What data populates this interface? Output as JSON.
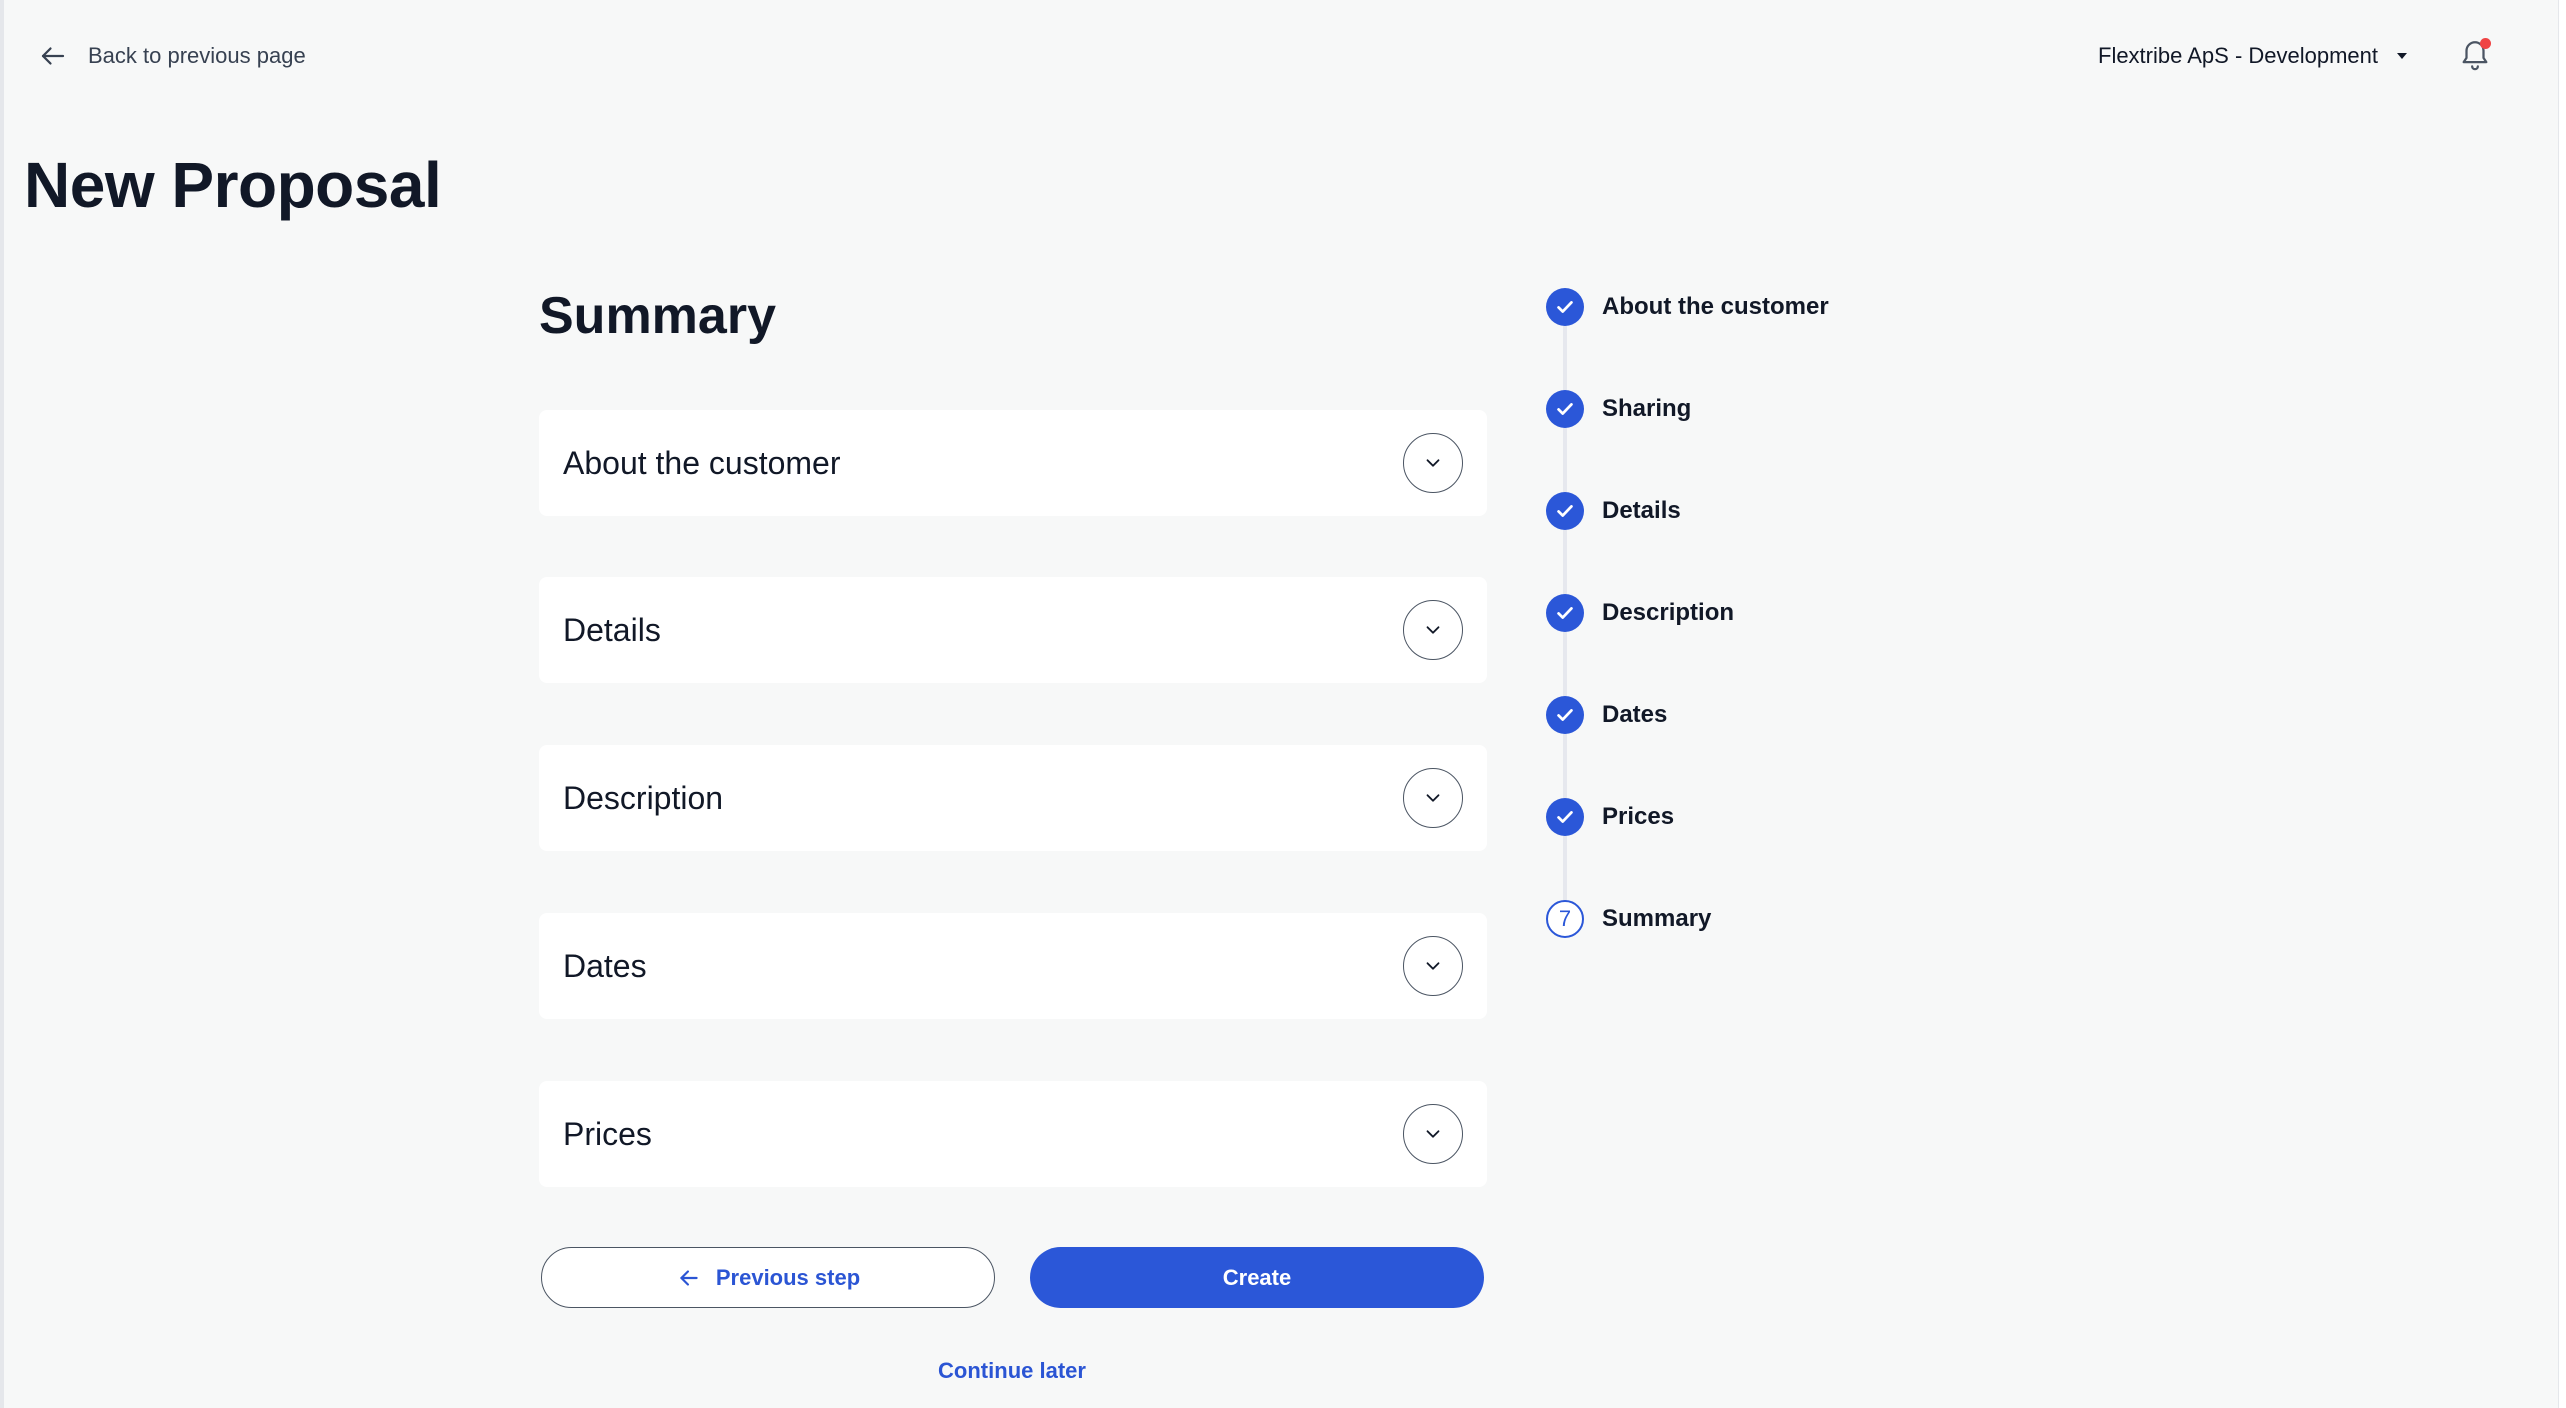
{
  "header": {
    "back_label": "Back to previous page",
    "org_name": "Flextribe ApS - Development",
    "has_notification": true
  },
  "page_title": "New Proposal",
  "main": {
    "section_title": "Summary",
    "cards": [
      {
        "label": "About the customer"
      },
      {
        "label": "Details"
      },
      {
        "label": "Description"
      },
      {
        "label": "Dates"
      },
      {
        "label": "Prices"
      }
    ],
    "previous_label": "Previous step",
    "create_label": "Create",
    "continue_later_label": "Continue later"
  },
  "stepper": {
    "steps": [
      {
        "label": "About the customer",
        "status": "completed"
      },
      {
        "label": "Sharing",
        "status": "completed"
      },
      {
        "label": "Details",
        "status": "completed"
      },
      {
        "label": "Description",
        "status": "completed"
      },
      {
        "label": "Dates",
        "status": "completed"
      },
      {
        "label": "Prices",
        "status": "completed"
      },
      {
        "label": "Summary",
        "status": "current",
        "number": "7"
      }
    ]
  },
  "colors": {
    "accent": "#2b57d8",
    "link": "#2b55d4",
    "background": "#f7f8f8",
    "notification_dot": "#ef4444"
  }
}
